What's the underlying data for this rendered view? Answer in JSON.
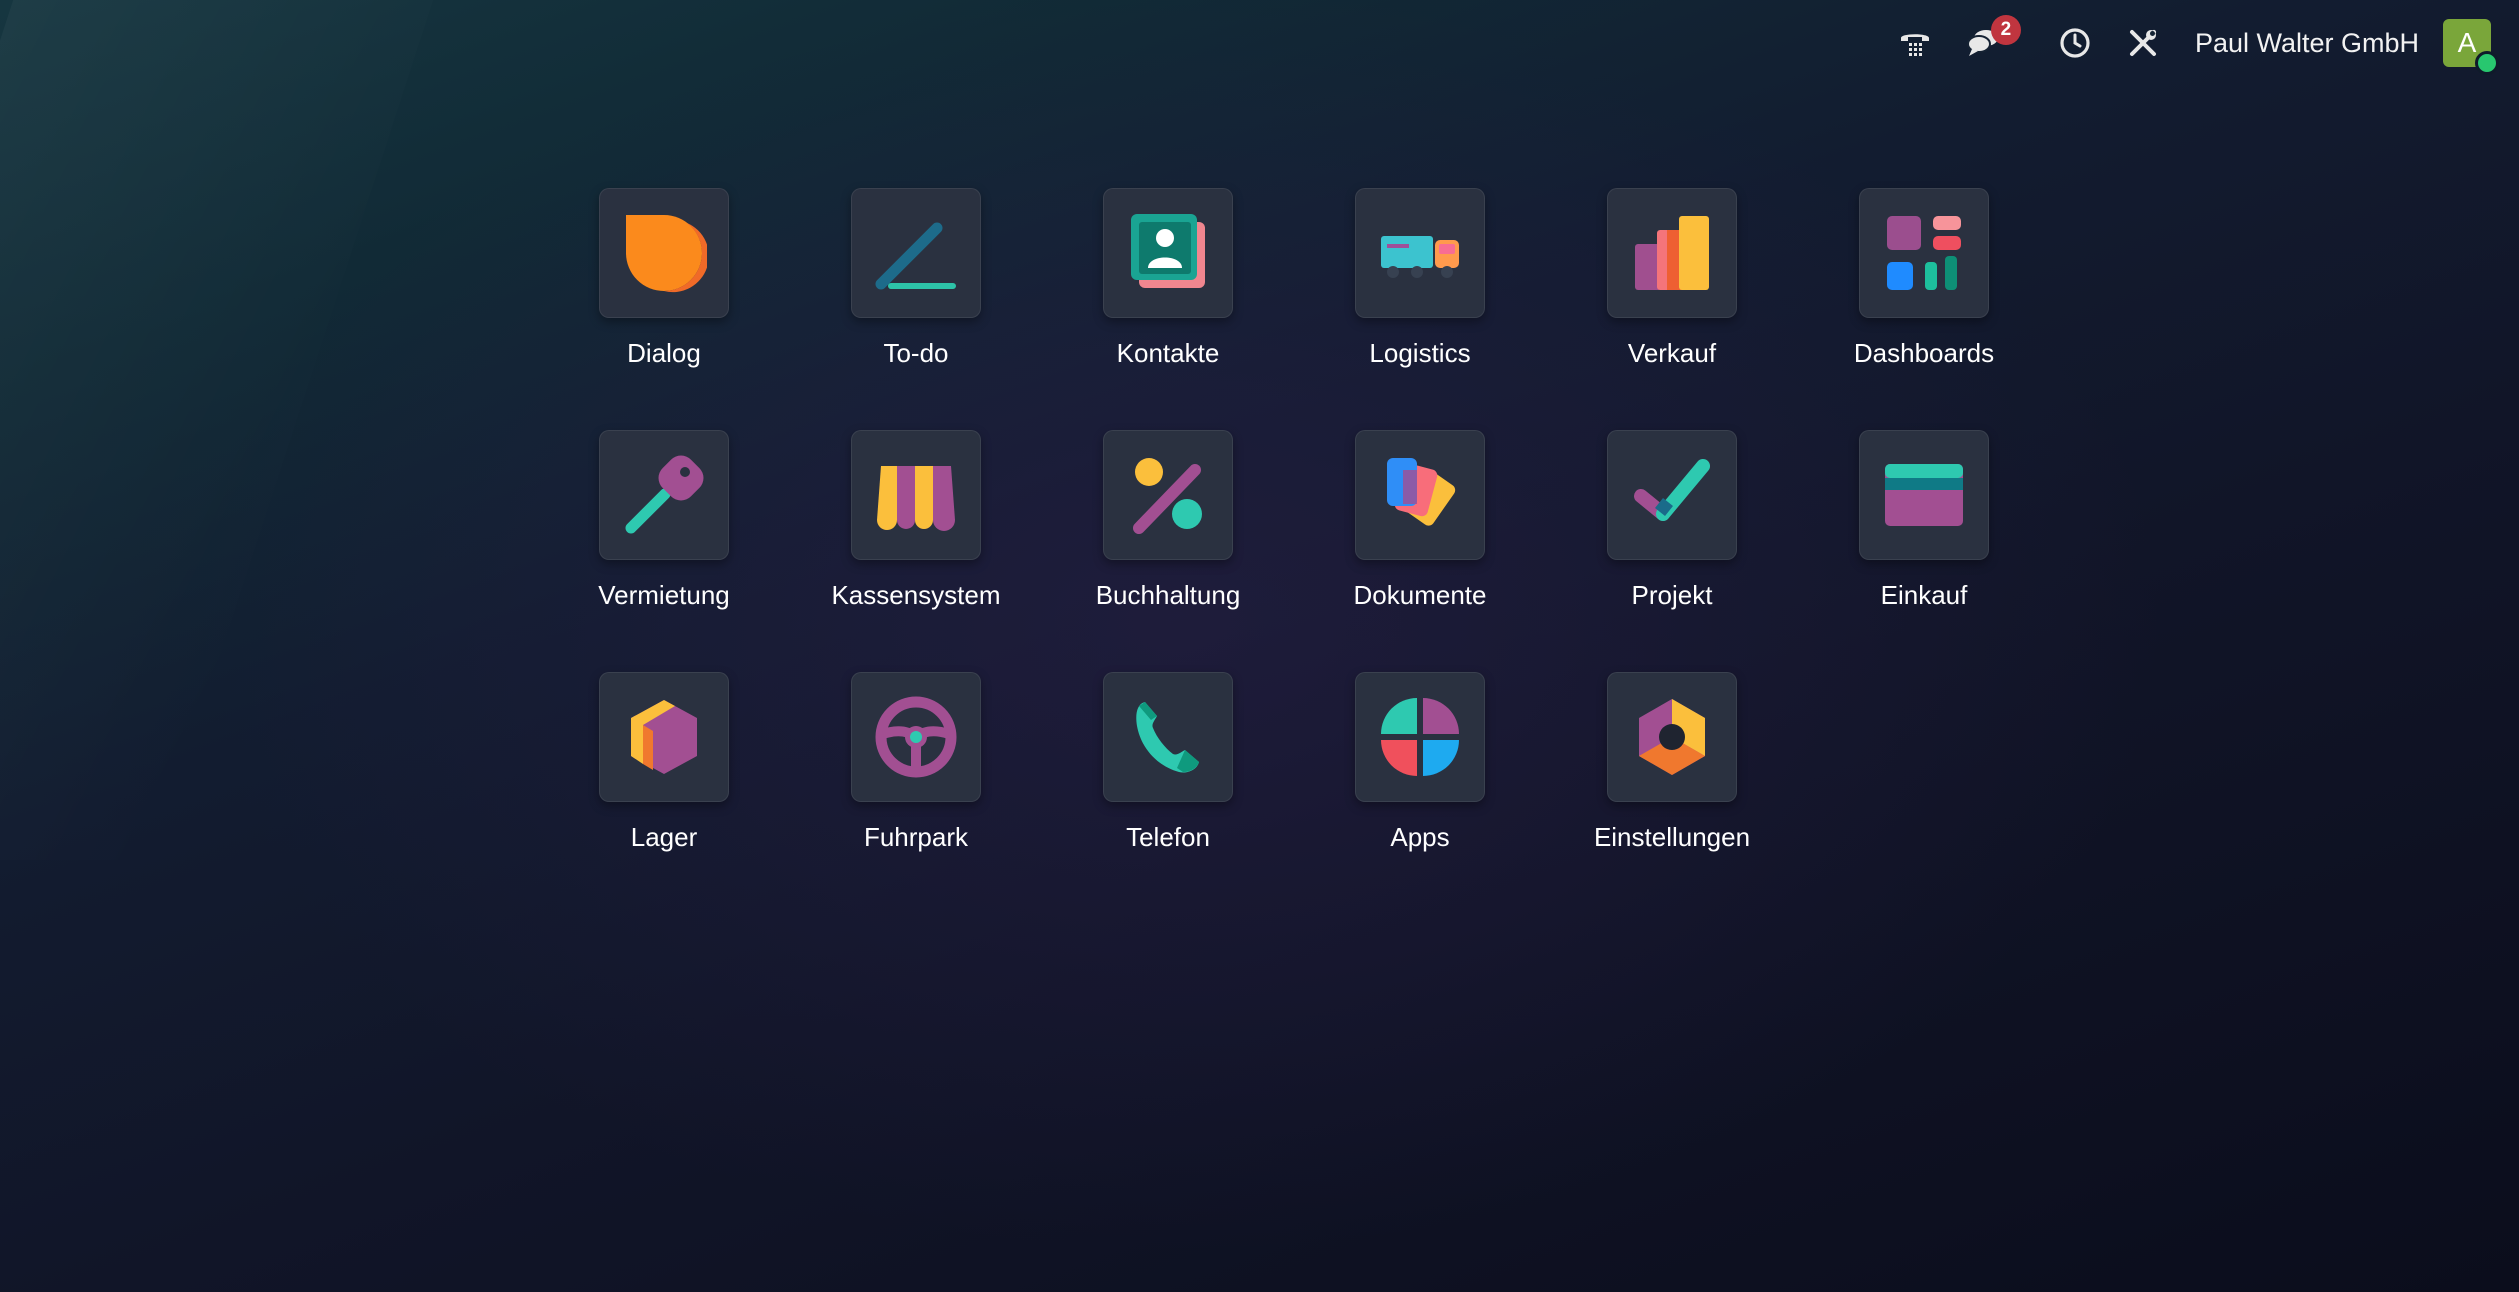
{
  "navbar": {
    "company_name": "Paul Walter GmbH",
    "messages_badge": "2",
    "avatar_letter": "A",
    "icons": [
      "phone-icon",
      "chat-icon",
      "clock-icon",
      "tools-icon"
    ]
  },
  "apps": [
    {
      "label": "Dialog",
      "icon": "dialog-icon"
    },
    {
      "label": "To-do",
      "icon": "todo-icon"
    },
    {
      "label": "Kontakte",
      "icon": "contacts-icon"
    },
    {
      "label": "Logistics",
      "icon": "truck-icon"
    },
    {
      "label": "Verkauf",
      "icon": "sales-chart-icon"
    },
    {
      "label": "Dashboards",
      "icon": "dashboard-icon"
    },
    {
      "label": "Vermietung",
      "icon": "key-icon"
    },
    {
      "label": "Kassensystem",
      "icon": "shop-awning-icon"
    },
    {
      "label": "Buchhaltung",
      "icon": "percent-icon"
    },
    {
      "label": "Dokumente",
      "icon": "documents-icon"
    },
    {
      "label": "Projekt",
      "icon": "checkmark-icon"
    },
    {
      "label": "Einkauf",
      "icon": "credit-card-icon"
    },
    {
      "label": "Lager",
      "icon": "box-icon"
    },
    {
      "label": "Fuhrpark",
      "icon": "steering-wheel-icon"
    },
    {
      "label": "Telefon",
      "icon": "telephone-icon"
    },
    {
      "label": "Apps",
      "icon": "apps-icon"
    },
    {
      "label": "Einstellungen",
      "icon": "settings-icon"
    }
  ],
  "colors": {
    "tile_background": "#2a3140",
    "badge": "#c0353f",
    "avatar": "#7aa63a",
    "presence": "#28c76f"
  }
}
